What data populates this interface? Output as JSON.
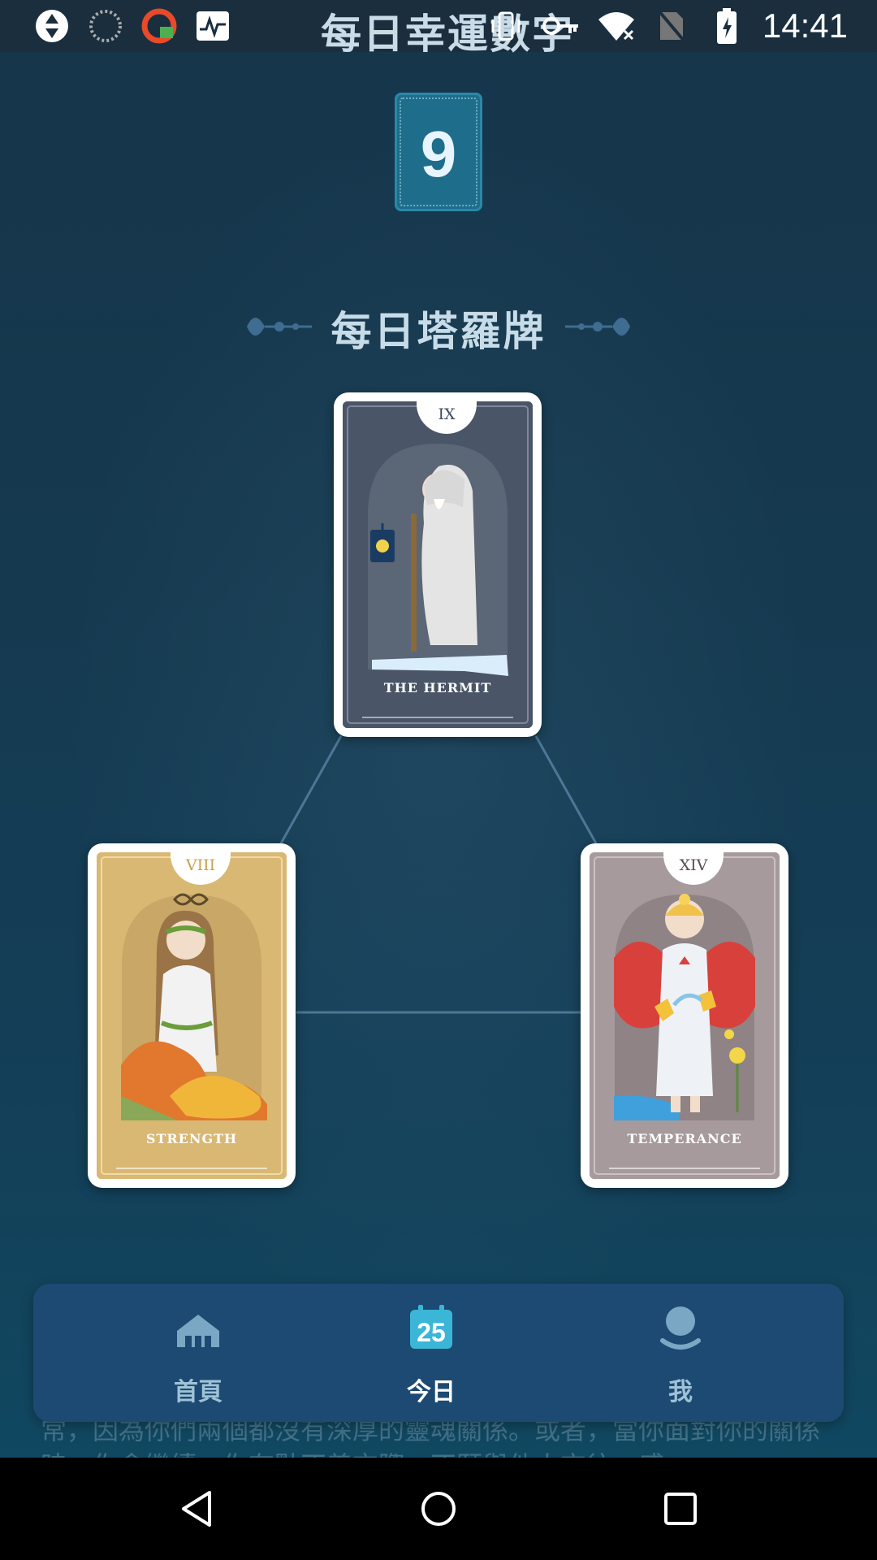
{
  "status_bar": {
    "app_title": "每日幸運數字",
    "time": "14:41",
    "icons": [
      "camera-shutter-icon",
      "loading-circle-icon",
      "vpn-shield-icon",
      "activity-monitor-icon",
      "vibrate-icon",
      "key-icon",
      "wifi-icon",
      "no-sim-icon",
      "battery-charging-icon"
    ]
  },
  "lucky_number": "9",
  "section_title": "每日塔羅牌",
  "cards": {
    "top": {
      "numeral": "IX",
      "name": "THE HERMIT"
    },
    "left": {
      "numeral": "VIII",
      "name": "STRENGTH"
    },
    "right": {
      "numeral": "XIV",
      "name": "TEMPERANCE"
    }
  },
  "under_text": "常，因為你們兩個都沒有深厚的靈魂關係。或者，當你面對你的關係時，你會繼續，你有點不善交際，不願與他人交往，感",
  "tabs": [
    {
      "label": "首頁",
      "icon": "home-icon",
      "active": false
    },
    {
      "label": "今日",
      "icon": "calendar-icon",
      "icon_text": "25",
      "active": true
    },
    {
      "label": "我",
      "icon": "profile-icon",
      "active": false
    }
  ],
  "colors": {
    "tab_active": "#ffffff",
    "tab_inactive": "#9fc2d6",
    "tab_bar": "#1c4a73",
    "hermit_card": "#4a5567",
    "strength_card": "#d9b874",
    "temperance_card": "#a69a9c"
  }
}
